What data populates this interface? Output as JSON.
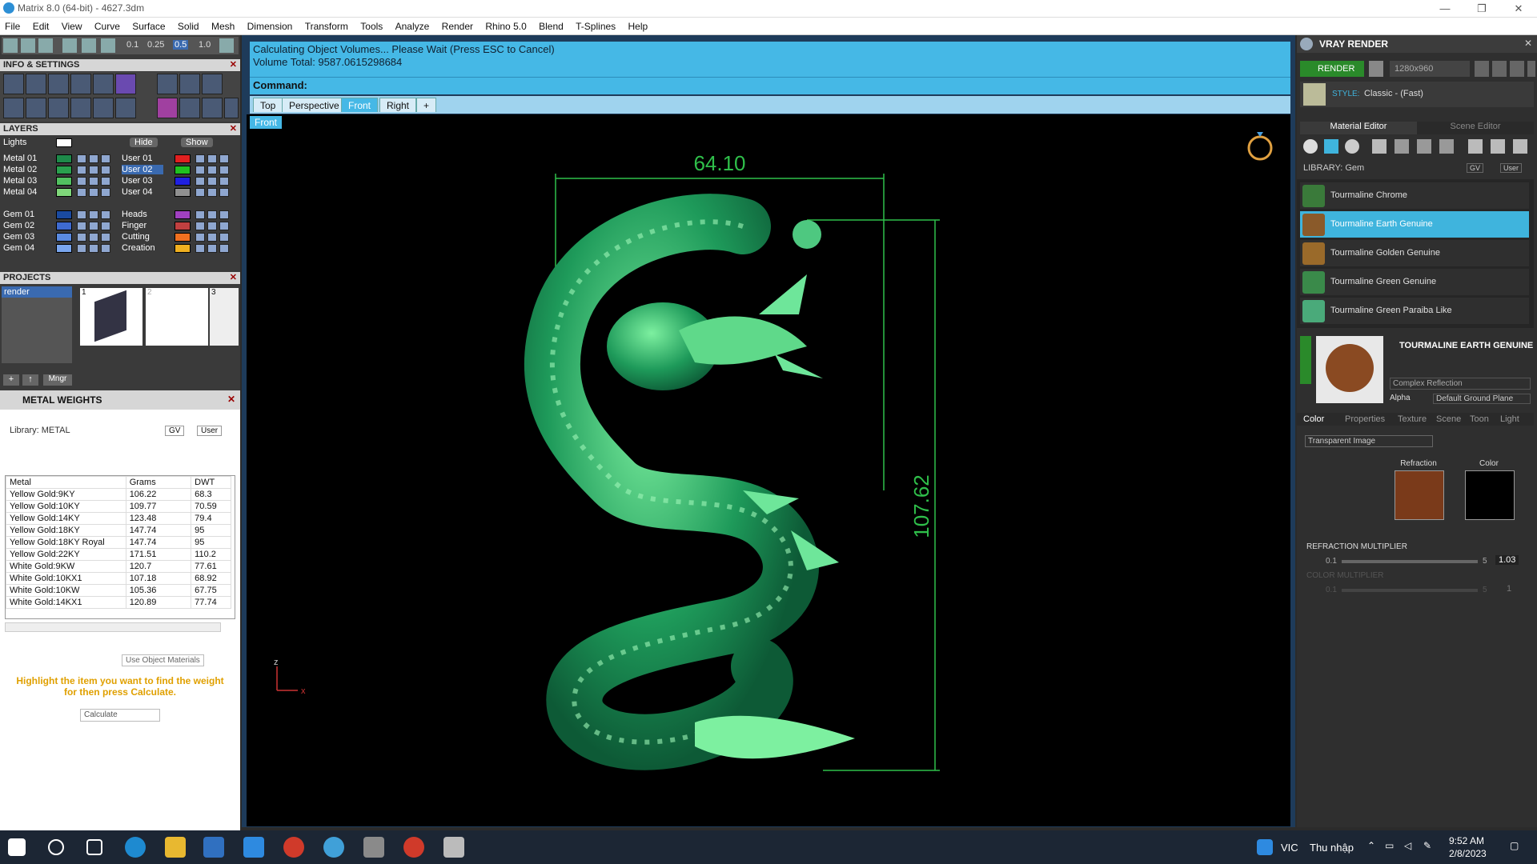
{
  "window": {
    "title": "Matrix 8.0 (64-bit) - 4627.3dm",
    "minimize": "—",
    "maximize": "❐",
    "close": "✕"
  },
  "menu": [
    "File",
    "Edit",
    "View",
    "Curve",
    "Surface",
    "Solid",
    "Mesh",
    "Dimension",
    "Transform",
    "Tools",
    "Analyze",
    "Render",
    "Rhino 5.0",
    "Blend",
    "T-Splines",
    "Help"
  ],
  "toolbar_values": [
    "0.1",
    "0.25",
    "0.5",
    "1.0"
  ],
  "info_settings": {
    "title": "INFO & SETTINGS"
  },
  "layers": {
    "title": "LAYERS",
    "lights_label": "Lights",
    "hide_label": "Hide",
    "show_label": "Show",
    "left": [
      "Metal 01",
      "Metal 02",
      "Metal 03",
      "Metal 04",
      "Gem 01",
      "Gem 02",
      "Gem 03",
      "Gem 04"
    ],
    "right": [
      "User 01",
      "User 02",
      "User 03",
      "User 04",
      "Heads",
      "Finger",
      "Cutting",
      "Creation"
    ],
    "left_colors": [
      "#1e8a4a",
      "#2aa04e",
      "#52c060",
      "#7fd67a",
      "#1a4aa0",
      "#3e6ad0",
      "#5a8ae0",
      "#7aa6ee"
    ],
    "right_colors": [
      "#e02020",
      "#20c020",
      "#2020e0",
      "#909090",
      "#a040c0",
      "#c04040",
      "#f07020",
      "#f0b020"
    ]
  },
  "projects": {
    "title": "PROJECTS",
    "item": "render",
    "thumb_labels": [
      "1",
      "2",
      "3"
    ],
    "mngr": "Mngr"
  },
  "metal_weights": {
    "title": "METAL WEIGHTS",
    "library": "Library: METAL",
    "gv": "GV",
    "user": "User",
    "headers": [
      "Metal",
      "Grams",
      "DWT"
    ],
    "rows": [
      [
        "Yellow Gold:9KY",
        "106.22",
        "68.3"
      ],
      [
        "Yellow Gold:10KY",
        "109.77",
        "70.59"
      ],
      [
        "Yellow Gold:14KY",
        "123.48",
        "79.4"
      ],
      [
        "Yellow Gold:18KY",
        "147.74",
        "95"
      ],
      [
        "Yellow Gold:18KY Royal",
        "147.74",
        "95"
      ],
      [
        "Yellow Gold:22KY",
        "171.51",
        "110.2"
      ],
      [
        "White Gold:9KW",
        "120.7",
        "77.61"
      ],
      [
        "White Gold:10KX1",
        "107.18",
        "68.92"
      ],
      [
        "White Gold:10KW",
        "105.36",
        "67.75"
      ],
      [
        "White Gold:14KX1",
        "120.89",
        "77.74"
      ]
    ],
    "use_object_materials": "Use Object Materials",
    "hint": "Highlight the item you want to find the weight for then press Calculate.",
    "calculate": "Calculate"
  },
  "command": {
    "line1": "Calculating Object Volumes... Please Wait (Press ESC to Cancel)",
    "line2": "Volume Total: 9587.0615298684",
    "label": "Command:"
  },
  "viewport_tabs": [
    "Top",
    "Perspective",
    "Front",
    "Right"
  ],
  "viewport": {
    "label": "Front",
    "dim_width": "64.10",
    "dim_height": "107.62",
    "axis_z": "z",
    "axis_x": "x"
  },
  "vray": {
    "title": "VRAY RENDER",
    "render_button": "RENDER",
    "resolution": "1280x960",
    "style_label": "STYLE:",
    "style_value": "Classic - (Fast)",
    "tabs": [
      "Material Editor",
      "Scene Editor"
    ],
    "library": "LIBRARY: Gem",
    "gv": "GV",
    "user": "User",
    "materials": [
      "Tourmaline Chrome",
      "Tourmaline Earth Genuine",
      "Tourmaline Golden Genuine",
      "Tourmaline Green Genuine",
      "Tourmaline Green Paraiba Like"
    ],
    "material_colors": [
      "#3a7a3a",
      "#8a5a2a",
      "#9a6a2a",
      "#3a8a4a",
      "#4aaa7a"
    ],
    "selected_name": "TOURMALINE EARTH GENUINE",
    "reflection": "Complex Reflection",
    "alpha": "Alpha",
    "ground": "Default Ground Plane",
    "sub_tabs": [
      "Color",
      "Properties",
      "Texture",
      "Scene",
      "Toon",
      "Light"
    ],
    "transparent": "Transparent Image",
    "refraction_label": "Refraction",
    "color_label": "Color",
    "refraction_multiplier": "REFRACTION MULTIPLIER",
    "ref_min": "0.1",
    "ref_max": "5",
    "ref_val": "1.03",
    "color_multiplier": "COLOR MULTIPLIER",
    "col_min": "0.1",
    "col_max": "5",
    "col_val": "1"
  },
  "taskbar": {
    "lang": "VIC",
    "ime": "Thu nhập",
    "time": "9:52 AM",
    "date": "2/8/2023"
  }
}
